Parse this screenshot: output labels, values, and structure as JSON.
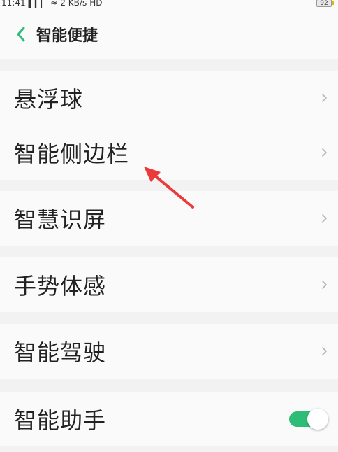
{
  "status_bar": {
    "time": "11:41",
    "signal": "▍▎▏",
    "wifi": "≈",
    "speed": "2 KB/s",
    "hd": "HD",
    "battery": "92"
  },
  "header": {
    "title": "智能便捷"
  },
  "groups": [
    {
      "items": [
        {
          "label": "悬浮球"
        },
        {
          "label": "智能侧边栏"
        }
      ]
    },
    {
      "items": [
        {
          "label": "智慧识屏"
        }
      ]
    },
    {
      "items": [
        {
          "label": "手势体感"
        }
      ]
    },
    {
      "items": [
        {
          "label": "智能驾驶"
        }
      ]
    },
    {
      "items": [
        {
          "label": "智能助手",
          "toggle_on": true
        }
      ]
    }
  ],
  "colors": {
    "accent": "#2ebd76",
    "annotation_arrow": "#ea3a3a",
    "background": "#f2f2f2",
    "card": "#fafafa"
  }
}
